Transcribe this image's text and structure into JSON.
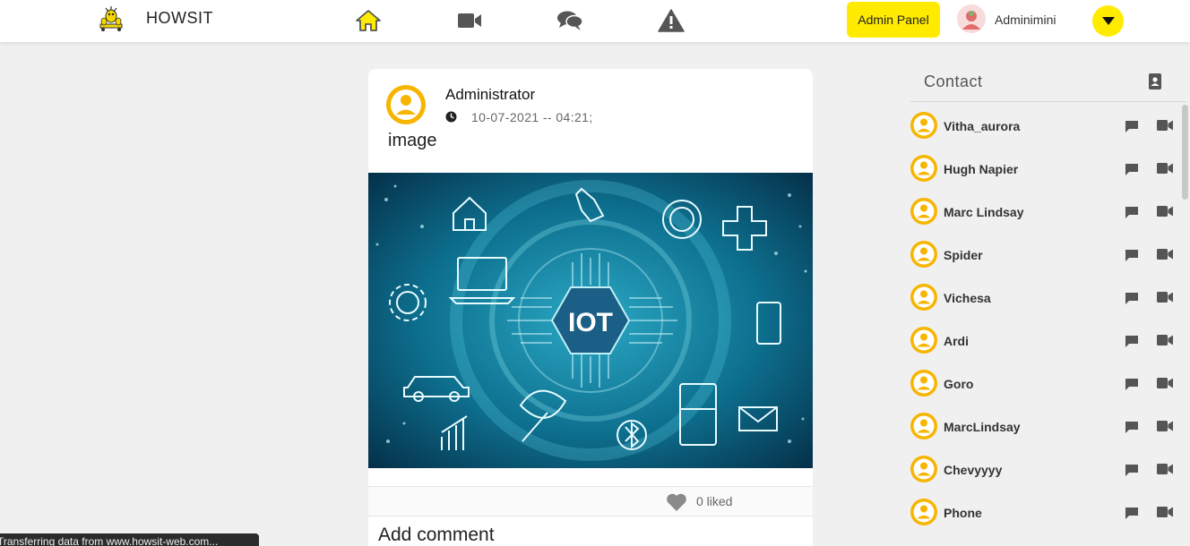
{
  "header": {
    "brand": "HOWSIT",
    "admin_button": "Admin Panel",
    "user_name": "Adminimini",
    "nav": [
      "home-icon",
      "video-icon",
      "chat-icon",
      "alert-icon"
    ],
    "accent_color": "#ffeb00"
  },
  "post": {
    "author": "Administrator",
    "timestamp": "10-07-2021 -- 04:21;",
    "text": "image",
    "image_label": "IOT",
    "likes": "0 liked",
    "comment_placeholder": "Add comment"
  },
  "contacts": {
    "title": "Contact",
    "items": [
      {
        "name": "Vitha_aurora"
      },
      {
        "name": "Hugh Napier"
      },
      {
        "name": "Marc Lindsay"
      },
      {
        "name": "Spider"
      },
      {
        "name": "Vichesa"
      },
      {
        "name": "Ardi"
      },
      {
        "name": "Goro"
      },
      {
        "name": "MarcLindsay"
      },
      {
        "name": "Chevyyyy"
      },
      {
        "name": "Phone"
      }
    ]
  },
  "status": {
    "text": "Transferring data from www.howsit-web.com..."
  }
}
